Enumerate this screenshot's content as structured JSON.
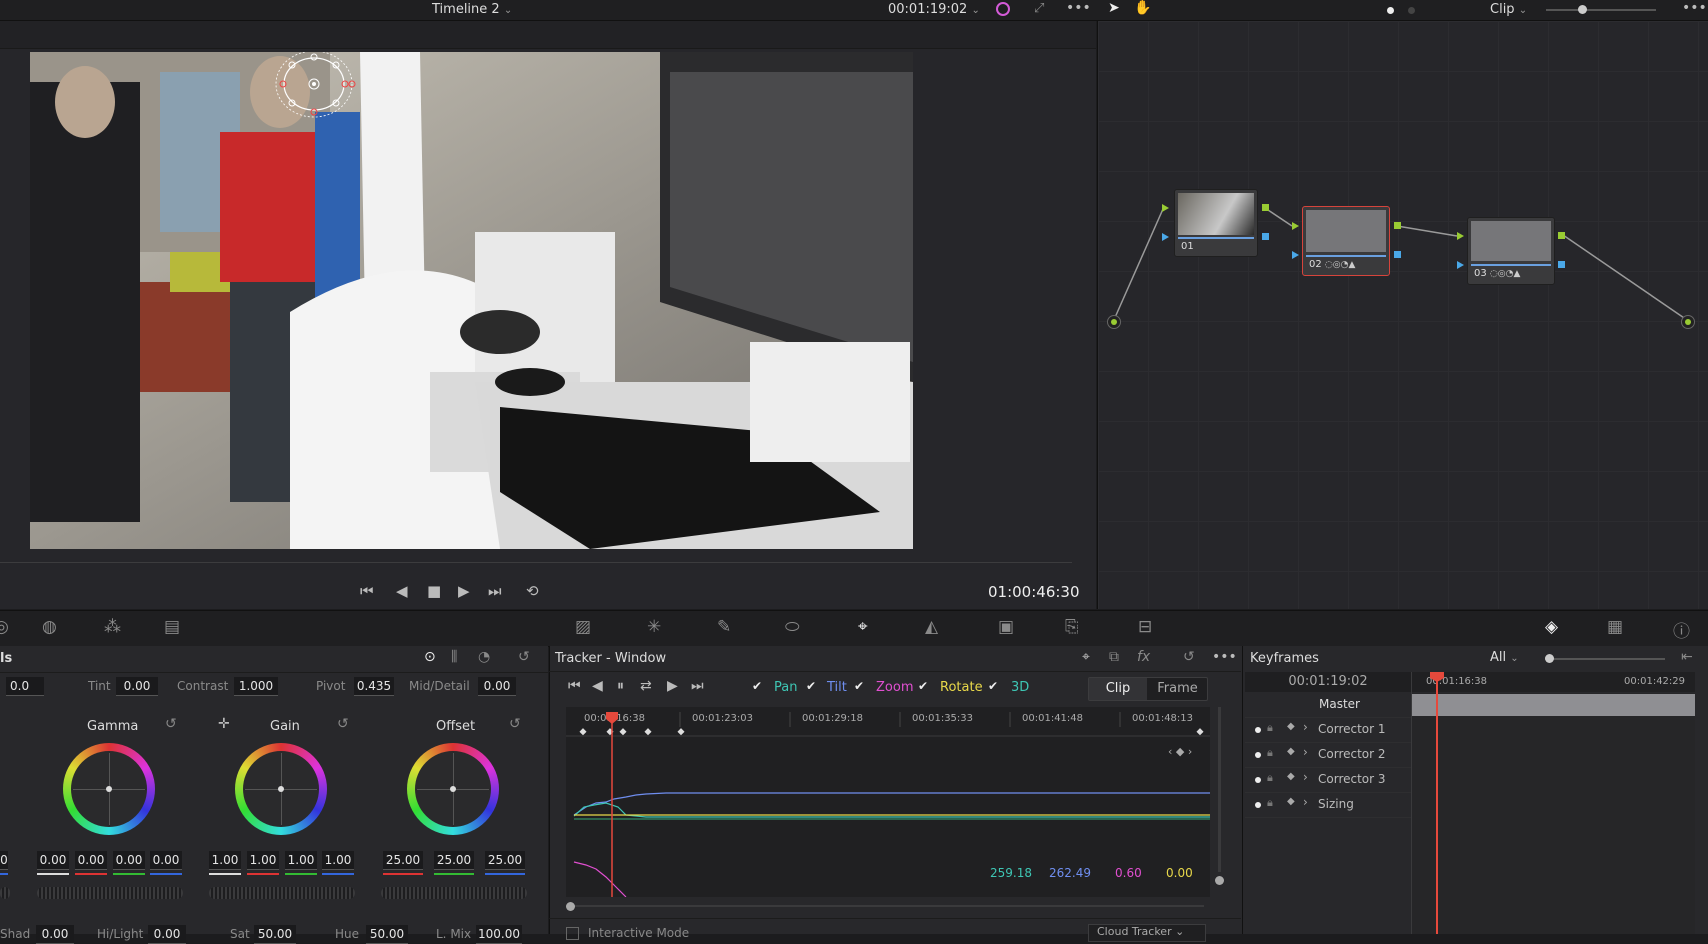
{
  "viewer": {
    "timeline_name": "Timeline 2",
    "timecode_top": "00:01:19:02",
    "playhead_timecode": "01:00:46:30",
    "clip_mode": "Clip"
  },
  "node_graph": {
    "nodes": [
      {
        "label": "01"
      },
      {
        "label": "02"
      },
      {
        "label": "03"
      }
    ]
  },
  "color_panel": {
    "title": "ls",
    "top_row": {
      "first_value": "0.0",
      "tint_label": "Tint",
      "tint_value": "0.00",
      "contrast_label": "Contrast",
      "contrast_value": "1.000",
      "pivot_label": "Pivot",
      "pivot_value": "0.435",
      "middetail_label": "Mid/Detail",
      "middetail_value": "0.00"
    },
    "wheels": [
      {
        "name": "Gamma",
        "values": [
          "0.00",
          "0.00",
          "0.00",
          "0.00"
        ]
      },
      {
        "name": "Gain",
        "values": [
          "1.00",
          "1.00",
          "1.00",
          "1.00"
        ]
      },
      {
        "name": "Offset",
        "values": [
          "25.00",
          "25.00",
          "25.00"
        ]
      }
    ],
    "bottom_row": {
      "shad_label": "Shad",
      "shad_value": "0.00",
      "hilight_label": "Hi/Light",
      "hilight_value": "0.00",
      "sat_label": "Sat",
      "sat_value": "50.00",
      "hue_label": "Hue",
      "hue_value": "50.00",
      "lmix_label": "L. Mix",
      "lmix_value": "100.00"
    },
    "left_edge_value": "0"
  },
  "tracker": {
    "title": "Tracker - Window",
    "options": [
      {
        "label": "Pan",
        "color": "#3ec6b4"
      },
      {
        "label": "Tilt",
        "color": "#6f8ef0"
      },
      {
        "label": "Zoom",
        "color": "#e04fd0"
      },
      {
        "label": "Rotate",
        "color": "#e8d84a"
      },
      {
        "label": "3D",
        "color": "#3ec6b4"
      }
    ],
    "modes": [
      "Clip",
      "Frame"
    ],
    "ruler": [
      "00:01:16:38",
      "00:01:23:03",
      "00:01:29:18",
      "00:01:35:33",
      "00:01:41:48",
      "00:01:48:13"
    ],
    "readouts": [
      {
        "value": "259.18",
        "color": "#3ec6b4"
      },
      {
        "value": "262.49",
        "color": "#6f8ef0"
      },
      {
        "value": "0.60",
        "color": "#e04fd0"
      },
      {
        "value": "0.00",
        "color": "#e8d84a"
      }
    ],
    "interactive_mode_label": "Interactive Mode",
    "cloud_tracker_label": "Cloud Tracker"
  },
  "keyframes": {
    "title": "Keyframes",
    "filter": "All",
    "timecode": "00:01:19:02",
    "ruler": [
      "00:01:16:38",
      "00:01:42:29"
    ],
    "rows": [
      "Master",
      "Corrector 1",
      "Corrector 2",
      "Corrector 3",
      "Sizing"
    ]
  }
}
